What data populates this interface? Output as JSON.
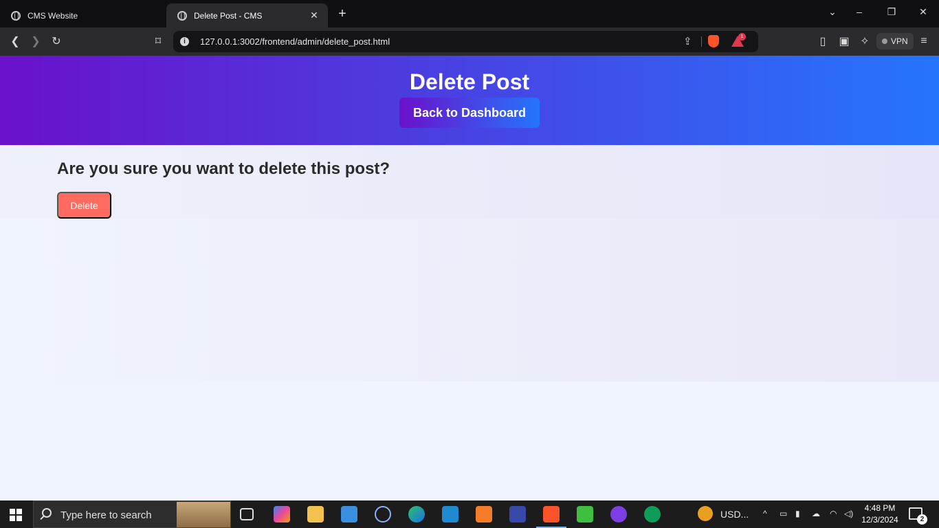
{
  "browser": {
    "tabs": [
      {
        "title": "CMS Website"
      },
      {
        "title": "Delete Post - CMS"
      }
    ],
    "url": "127.0.0.1:3002/frontend/admin/delete_post.html",
    "rewards_badge": "1",
    "vpn_label": "VPN"
  },
  "page": {
    "header_title": "Delete Post",
    "back_button": "Back to Dashboard",
    "question": "Are you sure you want to delete this post?",
    "delete_button": "Delete",
    "colors": {
      "gradient_start": "#6a11cb",
      "gradient_end": "#2575fc",
      "delete": "#ff6b61"
    }
  },
  "taskbar": {
    "search_placeholder": "Type here to search",
    "weather": "USD...",
    "time": "4:48 PM",
    "date": "12/3/2024",
    "notification_count": "2",
    "apps": [
      "task-view",
      "copilot",
      "file-explorer",
      "mail",
      "network-app",
      "edge",
      "vscode",
      "xampp",
      "kite",
      "brave",
      "sublime-app",
      "github-desktop",
      "mongodb-compass"
    ]
  }
}
